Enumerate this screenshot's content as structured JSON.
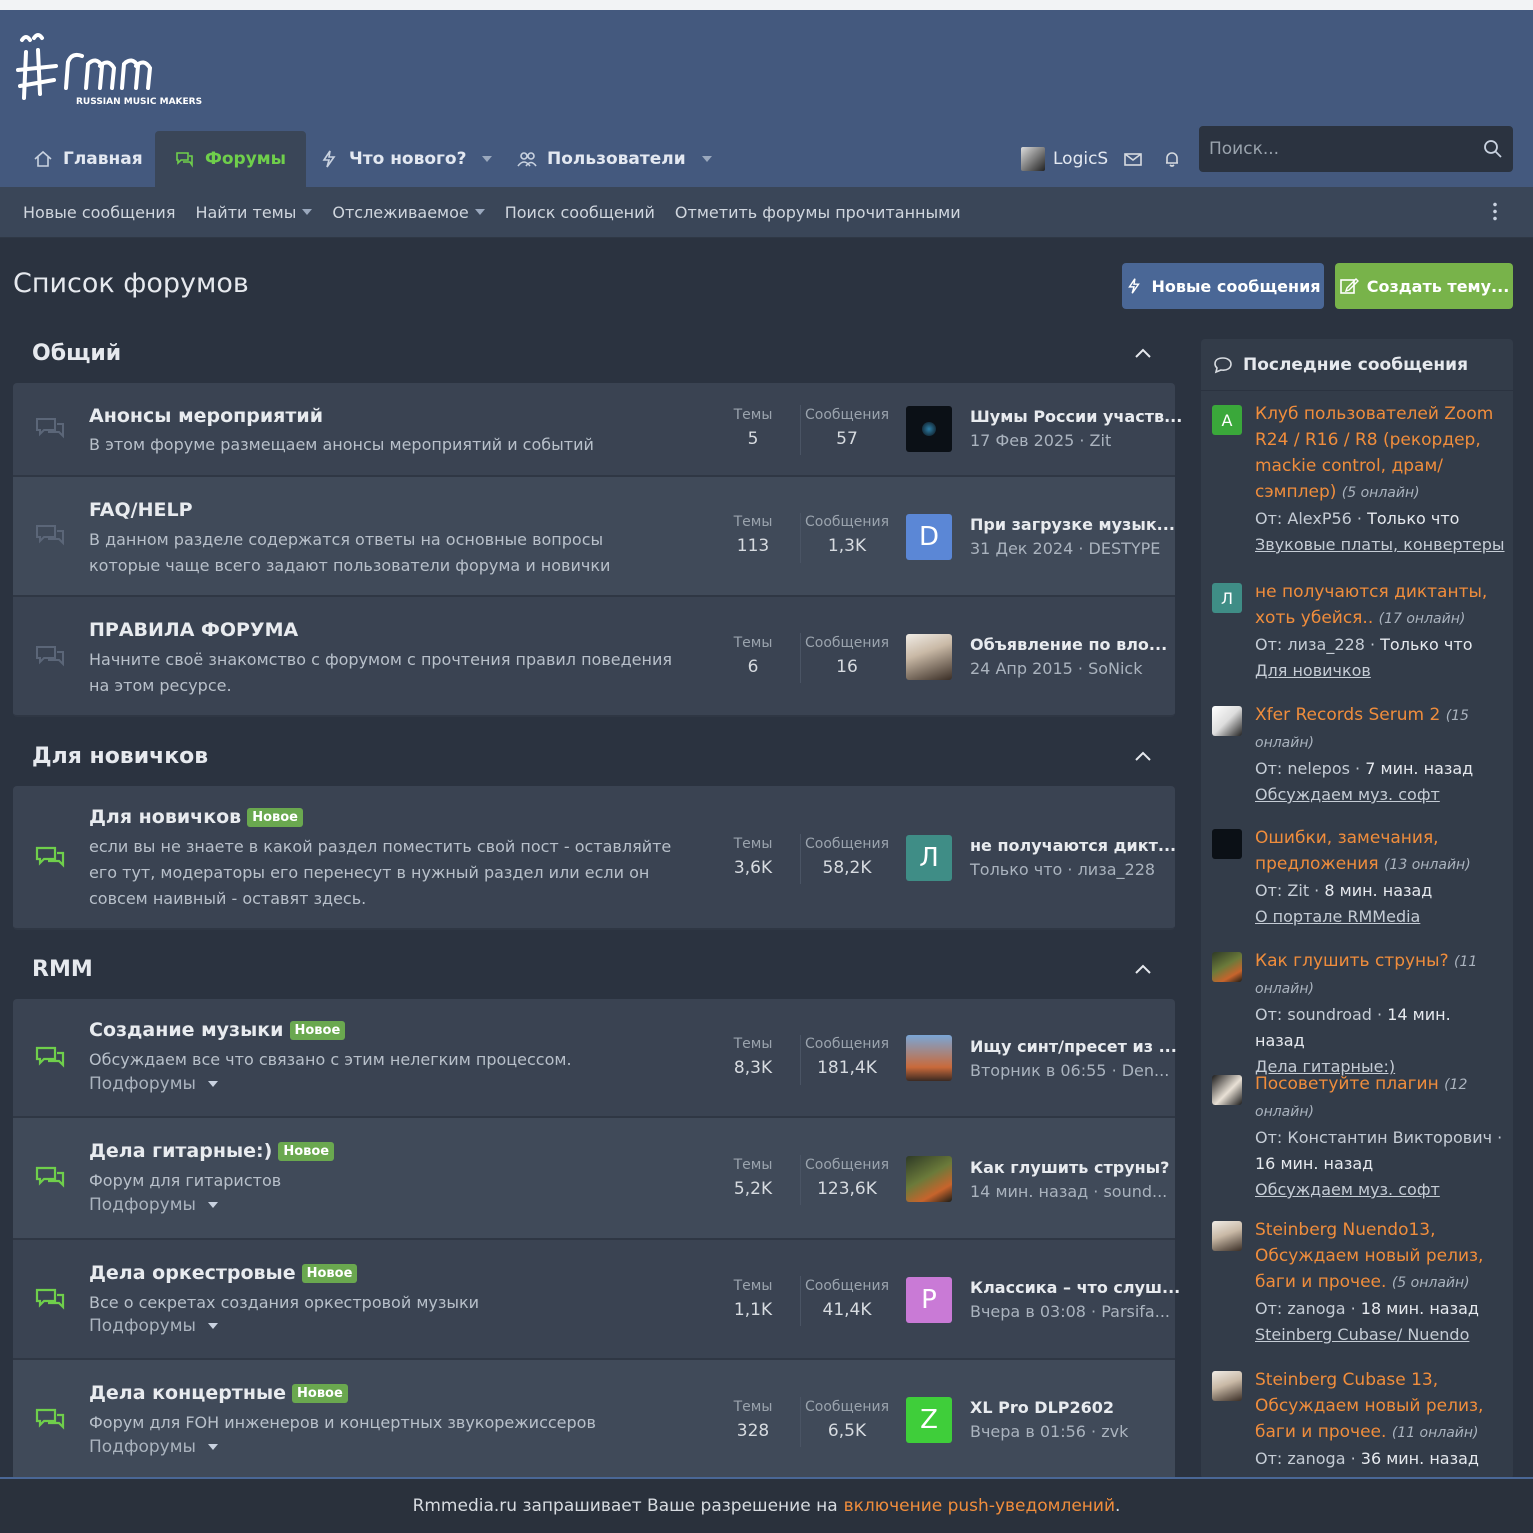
{
  "header": {
    "logo_text": "rmm",
    "logo_subtext": "RUSSIAN MUSIC MAKERS"
  },
  "nav": {
    "tabs": [
      "Главная",
      "Форумы",
      "Что нового?",
      "Пользователи"
    ],
    "username": "LogicS",
    "search_placeholder": "Поиск..."
  },
  "subnav": {
    "items": [
      "Новые сообщения",
      "Найти темы",
      "Отслеживаемое",
      "Поиск сообщений",
      "Отметить форумы прочитанными"
    ]
  },
  "page": {
    "title": "Список форумов",
    "btn_new": "Новые сообщения",
    "btn_create": "Создать тему..."
  },
  "labels": {
    "themes": "Темы",
    "messages": "Сообщения",
    "new_badge": "Новое",
    "subforums": "Подфорумы"
  },
  "categories": [
    "Общий",
    "Для новичков",
    "RMM"
  ],
  "forums": [
    {
      "title": "Анонсы мероприятий",
      "desc": "В этом форуме размещаем анонсы мероприятий и событий",
      "themes": "5",
      "messages": "57",
      "latest": "Шумы России участв...",
      "meta": "17 Фев 2025 · Zit",
      "avatar": ""
    },
    {
      "title": "FAQ/HELP",
      "desc": "В данном разделе содержатся ответы на основные вопросы которые чаще всего задают пользователи форума и новички",
      "themes": "113",
      "messages": "1,3K",
      "latest": "При загрузке музык...",
      "meta": "31 Дек 2024 · DESTYPE",
      "avatar": "D"
    },
    {
      "title": "ПРАВИЛА ФОРУМА",
      "desc": "Начните своё знакомство с форумом с прочтения правил поведения на этом ресурсе.",
      "themes": "6",
      "messages": "16",
      "latest": "Объявление по вло...",
      "meta": "24 Апр 2015 · SoNick",
      "avatar": ""
    },
    {
      "title": "Для новичков",
      "desc": "если вы не знаете в какой раздел поместить свой пост - оставляйте его тут, модераторы его перенесут в нужный раздел или если он совсем наивный - оставят здесь.",
      "themes": "3,6K",
      "messages": "58,2K",
      "latest": "не получаются дикт...",
      "meta": "Только что · лиза_228",
      "avatar": "Л"
    },
    {
      "title": "Создание музыки",
      "desc": "Обсуждаем все что связано с этим нелегким процессом.",
      "themes": "8,3K",
      "messages": "181,4K",
      "latest": "Ищу синт/пресет из ...",
      "meta": "Вторник в 06:55 · Den...",
      "avatar": ""
    },
    {
      "title": "Дела гитарные:)",
      "desc": "Форум для гитаристов",
      "themes": "5,2K",
      "messages": "123,6K",
      "latest": "Как глушить струны?",
      "meta": "14 мин. назад · sound...",
      "avatar": ""
    },
    {
      "title": "Дела оркестровые",
      "desc": "Все о секретах создания оркестровой музыки",
      "themes": "1,1K",
      "messages": "41,4K",
      "latest": "Классика – что слуш...",
      "meta": "Вчера в 03:08 · Parsifa...",
      "avatar": "P"
    },
    {
      "title": "Дела концертные",
      "desc": "Форум для FOH инженеров и концертных звукорежиссеров",
      "themes": "328",
      "messages": "6,5K",
      "latest": "XL Pro DLP2602",
      "meta": "Вчера в 01:56 · zvk",
      "avatar": "Z"
    }
  ],
  "sidebar": {
    "title": "Последние сообщения",
    "from_label": "От:",
    "items": [
      {
        "avatar": "A",
        "topic": "Клуб пользователей Zoom R24 / R16 / R8 (рекордер, mackie control, драм/ сэмплер)",
        "online": "(5 онлайн)",
        "author": "AlexP56",
        "time": "Только что",
        "forum": "Звуковые платы, конвертеры"
      },
      {
        "avatar": "Л",
        "topic": "не получаются диктанты, хоть убейся..",
        "online": "(17 онлайн)",
        "author": "лиза_228",
        "time": "Только что",
        "forum": "Для новичков"
      },
      {
        "avatar": "",
        "topic": "Xfer Records Serum 2",
        "online": "(15 онлайн)",
        "author": "nelepos",
        "time": "7 мин. назад",
        "forum": "Обсуждаем муз. софт"
      },
      {
        "avatar": "",
        "topic": "Ошибки, замечания, предложения",
        "online": "(13 онлайн)",
        "author": "Zit",
        "time": "8 мин. назад",
        "forum": "О портале RMMedia"
      },
      {
        "avatar": "",
        "topic": "Как глушить струны?",
        "online": "(11 онлайн)",
        "author": "soundroad",
        "time": "14 мин. назад",
        "forum": "Дела гитарные:)"
      },
      {
        "avatar": "",
        "topic": "Посоветуйте плагин",
        "online": "(12 онлайн)",
        "author": "Константин Викторович",
        "time": "16 мин. назад",
        "forum": "Обсуждаем муз. софт"
      },
      {
        "avatar": "",
        "topic": "Steinberg Nuendo13, Обсуждаем новый релиз, баги и прочее.",
        "online": "(5 онлайн)",
        "author": "zanoga",
        "time": "18 мин. назад",
        "forum": "Steinberg Cubase/ Nuendo"
      },
      {
        "avatar": "",
        "topic": "Steinberg Cubase 13, Обсуждаем новый релиз, баги и прочее.",
        "online": "(11 онлайн)",
        "author": "zanoga",
        "time": "36 мин. назад",
        "forum": ""
      }
    ]
  },
  "footer": {
    "text": "Rmmedia.ru запрашивает Ваше разрешение на",
    "link": "включение push-уведомлений",
    "end": "."
  },
  "colors": {
    "header": "#44597e",
    "accent_green": "#6fcf4b",
    "link_orange": "#f08d3c",
    "badge": "#6aa84f"
  }
}
